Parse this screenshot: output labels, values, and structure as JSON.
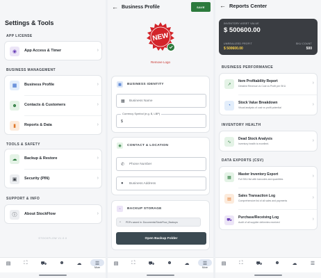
{
  "settings": {
    "title": "Settings & Tools",
    "sections": [
      {
        "label": "APP LICENSE",
        "items": [
          {
            "label": "App Access & Timer",
            "icon": "key-icon",
            "icon_bg": "#ece5f7",
            "icon_fg": "#6a3fb7"
          }
        ]
      },
      {
        "label": "BUSINESS MANAGEMENT",
        "items": [
          {
            "label": "Business Profile",
            "icon": "storefront-icon",
            "icon_bg": "#e3eefb",
            "icon_fg": "#2a62c9"
          },
          {
            "label": "Contacts & Customers",
            "icon": "people-icon",
            "icon_bg": "#e4f3e6",
            "icon_fg": "#2c7a3d"
          },
          {
            "label": "Reports & Data",
            "icon": "chart-icon",
            "icon_bg": "#fcebdc",
            "icon_fg": "#e0782b"
          }
        ]
      },
      {
        "label": "TOOLS & SAFETY",
        "items": [
          {
            "label": "Backup & Restore",
            "icon": "cloud-icon",
            "icon_bg": "#e4f3e6",
            "icon_fg": "#2c7a3d"
          },
          {
            "label": "Security (PIN)",
            "icon": "lock-icon",
            "icon_bg": "#eceef1",
            "icon_fg": "#3a3f46"
          }
        ]
      },
      {
        "label": "SUPPORT & INFO",
        "items": [
          {
            "label": "About StockFlow",
            "icon": "info-icon",
            "icon_bg": "#eceef1",
            "icon_fg": "#3a3f46"
          }
        ]
      }
    ],
    "version": "STOCKFLOW V1.0.0"
  },
  "nav": {
    "more_label": "More"
  },
  "profile": {
    "title": "Business Profile",
    "save_label": "SAVE",
    "logo_text": "NEW",
    "remove_logo": "Remove Logo",
    "identity_header": "BUSINESS IDENTITY",
    "business_name_placeholder": "Business Name",
    "currency_legend": "Currency Symbol (e.g. $, LBP)",
    "currency_value": "$",
    "contact_header": "CONTACT & LOCATION",
    "phone_placeholder": "Phone Number",
    "address_placeholder": "Business Address",
    "backup_header": "BACKUP STORAGE",
    "backup_path": "PDFs saved in: Documents/StockFlow_Backups",
    "open_folder": "Open Backup Folder"
  },
  "reports": {
    "title": "Reports Center",
    "value_card": {
      "asset_label": "INVENTORY ASSET VALUE",
      "asset_value": "$ 500600.00",
      "profit_label": "UNREALIZED PROFIT",
      "profit_value": "$ 500600.00",
      "sku_label": "SKU COUNT",
      "sku_value": "500"
    },
    "sections": [
      {
        "label": "BUSINESS PERFORMANCE",
        "items": [
          {
            "title": "Item Profitability Report",
            "sub": "Detailed Revenue vs Cost vs Profit per SKU",
            "icon": "trend-icon",
            "icon_bg": "#e4f3e6",
            "icon_fg": "#2c7a3d"
          },
          {
            "title": "Stock Value Breakdown",
            "sub": "Visual analysis of cost vs profit potential",
            "icon": "pie-icon",
            "icon_bg": "#e3eefb",
            "icon_fg": "#2a62c9"
          }
        ]
      },
      {
        "label": "INVENTORY HEALTH",
        "items": [
          {
            "title": "Dead Stock Analysis",
            "sub": "Inventory health is excellent.",
            "icon": "pulse-icon",
            "icon_bg": "#e4f3e6",
            "icon_fg": "#2c7a3d"
          }
        ]
      },
      {
        "label": "DATA EXPORTS (CSV)",
        "items": [
          {
            "title": "Master Inventory Export",
            "sub": "Full SKU list with barcodes and quantities",
            "icon": "grid-icon",
            "icon_bg": "#e4f3e6",
            "icon_fg": "#2c7a3d"
          },
          {
            "title": "Sales Transaction Log",
            "sub": "Comprehensive list of all sales and payments",
            "icon": "receipt-icon",
            "icon_bg": "#fcebdc",
            "icon_fg": "#e0782b"
          },
          {
            "title": "Purchase/Receiving Log",
            "sub": "Audit of all supplier deliveries received",
            "icon": "truck-icon",
            "icon_bg": "#ece5f7",
            "icon_fg": "#6a3fb7"
          }
        ]
      }
    ]
  }
}
